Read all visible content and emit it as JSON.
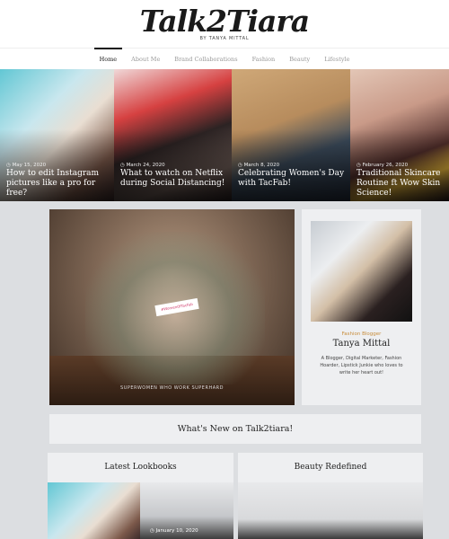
{
  "header": {
    "logo_text": "Talk2Tiara",
    "byline": "BY TANYA MITTAL"
  },
  "nav": {
    "items": [
      "Home",
      "About Me",
      "Brand Collaborations",
      "Fashion",
      "Beauty",
      "Lifestyle"
    ]
  },
  "hero_posts": [
    {
      "date": "May 15, 2020",
      "title": "How to edit Instagram pictures like a pro for free?"
    },
    {
      "date": "March 24, 2020",
      "title": "What to watch on Netflix during Social Distancing!"
    },
    {
      "date": "March 8, 2020",
      "title": "Celebrating Women's Day with TacFab!"
    },
    {
      "date": "February 26, 2020",
      "title": "Traditional Skincare Routine ft Wow Skin Science!"
    }
  ],
  "feature": {
    "sign_text": "#WomenOfTacFab",
    "caption": "SUPERWOMEN WHO WORK SUPERHARD"
  },
  "profile": {
    "tag": "Fashion Blogger",
    "name": "Tanya Mittal",
    "bio": "A Blogger, Digital Marketer, Fashion Hoarder, Lipstick Junkie who loves to write her heart out!"
  },
  "whats_new": "What's New on Talk2tiara!",
  "sections": {
    "left": "Latest Lookbooks",
    "right": "Beauty Redefined"
  },
  "lookbook_posts": [
    {
      "date": "January 10, 2020"
    }
  ],
  "icons": {
    "clock": "clock-icon"
  }
}
